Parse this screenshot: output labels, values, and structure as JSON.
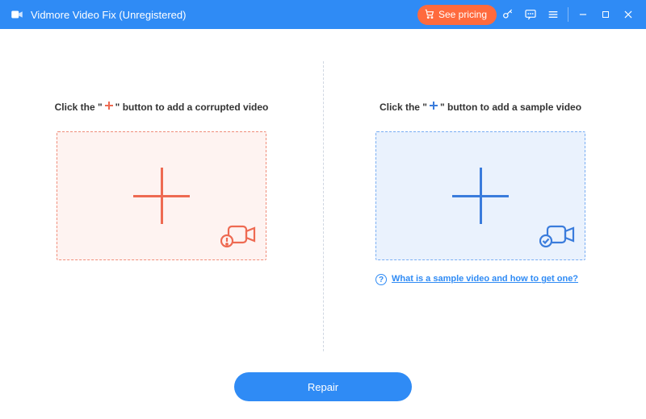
{
  "titlebar": {
    "title": "Vidmore Video Fix (Unregistered)",
    "see_pricing": "See pricing"
  },
  "panels": {
    "corrupted": {
      "title_prefix": "Click the \"",
      "title_suffix": "\" button to add a corrupted video"
    },
    "sample": {
      "title_prefix": "Click the \"",
      "title_suffix": "\" button to add a sample video",
      "help_link": "What is a sample video and how to get one?"
    }
  },
  "footer": {
    "repair": "Repair"
  },
  "colors": {
    "accent": "#2f8bf5",
    "warn": "#ee6a52",
    "pricing": "#ff6a3d"
  }
}
